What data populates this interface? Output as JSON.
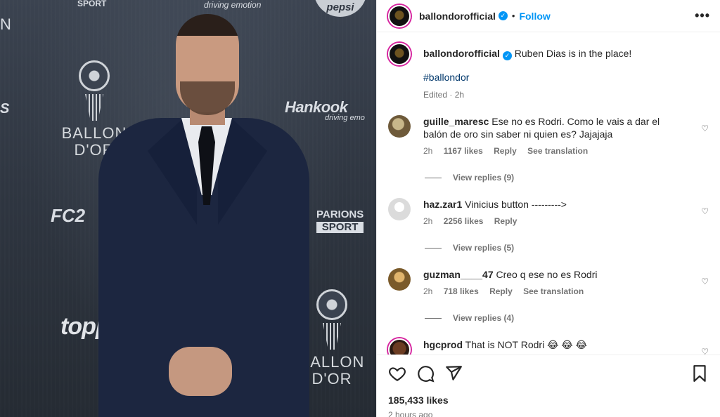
{
  "header": {
    "username": "ballondorofficial",
    "separator": "•",
    "follow_label": "Follow",
    "more_label": "•••"
  },
  "photo": {
    "sponsors": {
      "hankook": "Hankook",
      "driving_1": "driving emotion",
      "driving_2": "driving emo",
      "fc": "FC2",
      "parions_top": "PARIONS",
      "parions_bottom": "SPORT",
      "topps": "topps",
      "sport_top": "SPORT",
      "pepsi": "pepsi",
      "edge_n": "N",
      "edge_s": "S"
    },
    "ballon_1": "BALLON D'OR",
    "ballon_2": "BALLON D'OR"
  },
  "caption": {
    "username": "ballondorofficial",
    "text": "Ruben Dias is in the place!",
    "hashtag": "#ballondor",
    "meta": "Edited · 2h"
  },
  "comments": [
    {
      "username": "guille_maresc",
      "text": "Ese no es Rodri. Como le vais a dar el balón de oro sin saber ni quien es? Jajajaja",
      "time": "2h",
      "likes": "1167 likes",
      "reply": "Reply",
      "translate": "See translation",
      "view_replies": "View replies (9)"
    },
    {
      "username": "haz.zar1",
      "text": "Vinicius button --------->",
      "time": "2h",
      "likes": "2256 likes",
      "reply": "Reply",
      "translate": "",
      "view_replies": "View replies (5)"
    },
    {
      "username": "guzman____47",
      "text": "Creo q ese no es Rodri",
      "time": "2h",
      "likes": "718 likes",
      "reply": "Reply",
      "translate": "See translation",
      "view_replies": "View replies (4)"
    },
    {
      "username": "hgcprod",
      "text": "That is NOT Rodri 😂 😂 😂",
      "time": "",
      "likes": "",
      "reply": "",
      "translate": "",
      "view_replies": ""
    }
  ],
  "footer": {
    "likes": "185,433 likes",
    "time": "2 hours ago"
  },
  "icons": [
    "heart-icon",
    "comment-icon",
    "share-icon",
    "bookmark-icon",
    "verified-badge-icon",
    "more-options-icon"
  ],
  "colors": {
    "link": "#0095f6",
    "hashtag": "#00376b",
    "muted": "#737373",
    "suit": "#1c2640",
    "backdrop": "#2f3641"
  }
}
